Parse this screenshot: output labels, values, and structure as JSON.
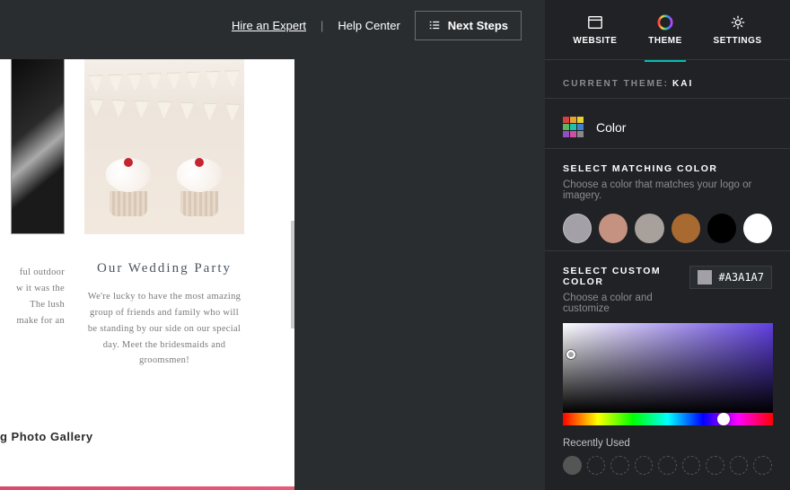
{
  "topbar": {
    "hire": "Hire an Expert",
    "help": "Help Center",
    "next": "Next Steps"
  },
  "canvas": {
    "card2_title": "Our Wedding Party",
    "card1_frag": "ful outdoor w it was the The lush make for an",
    "card2_text": "We're lucky to have the most amazing group of friends and family who will be standing by our side on our special day. Meet the bridesmaids and groomsmen!",
    "gallery_heading": "g Photo Gallery"
  },
  "tabs": {
    "website": "WEBSITE",
    "theme": "THEME",
    "settings": "SETTINGS"
  },
  "theme": {
    "current_label": "CURRENT THEME:",
    "current_value": "KAI",
    "color_section": "Color",
    "match_head": "SELECT MATCHING COLOR",
    "match_sub": "Choose a color that matches your logo or imagery.",
    "custom_head": "SELECT CUSTOM COLOR",
    "custom_sub": "Choose a color and customize",
    "hex": "#A3A1A7",
    "recent_label": "Recently Used"
  }
}
